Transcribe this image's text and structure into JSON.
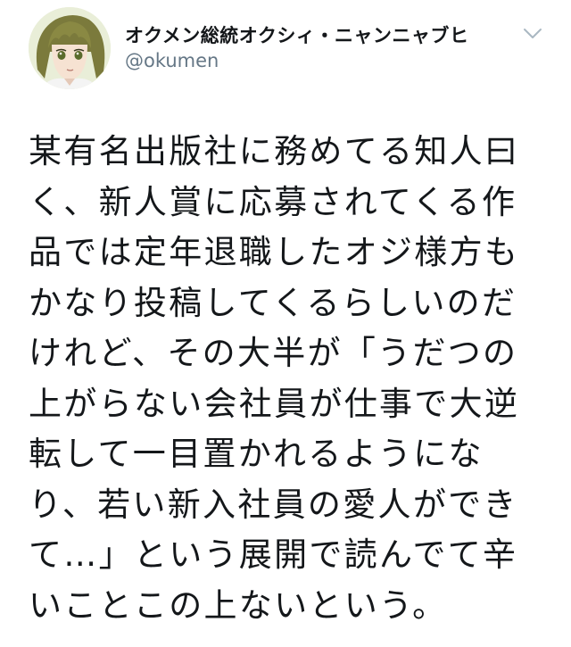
{
  "author": {
    "display_name": "オクメン総統オクシィ・ニャンニャブヒ",
    "handle": "@okumen",
    "avatar": "anime-character-avatar"
  },
  "menu": {
    "icon": "chevron-down-icon"
  },
  "tweet": {
    "lines": [
      "某有名出版社に務めてる知人曰",
      "く、新人賞に応募されてくる作",
      "品では定年退職したオジ様方も",
      "かなり投稿してくるらしいのだ",
      "けれど、その大半が「うだつの",
      "上がらない会社員が仕事で大逆",
      "転して一目置かれるようにな",
      "り、若い新入社員の愛人ができ",
      "て…」という展開で読んでて辛",
      "いことこの上ないという。"
    ]
  },
  "colors": {
    "text": "#14171a",
    "secondary": "#657786",
    "chevron": "#aab8c2"
  }
}
